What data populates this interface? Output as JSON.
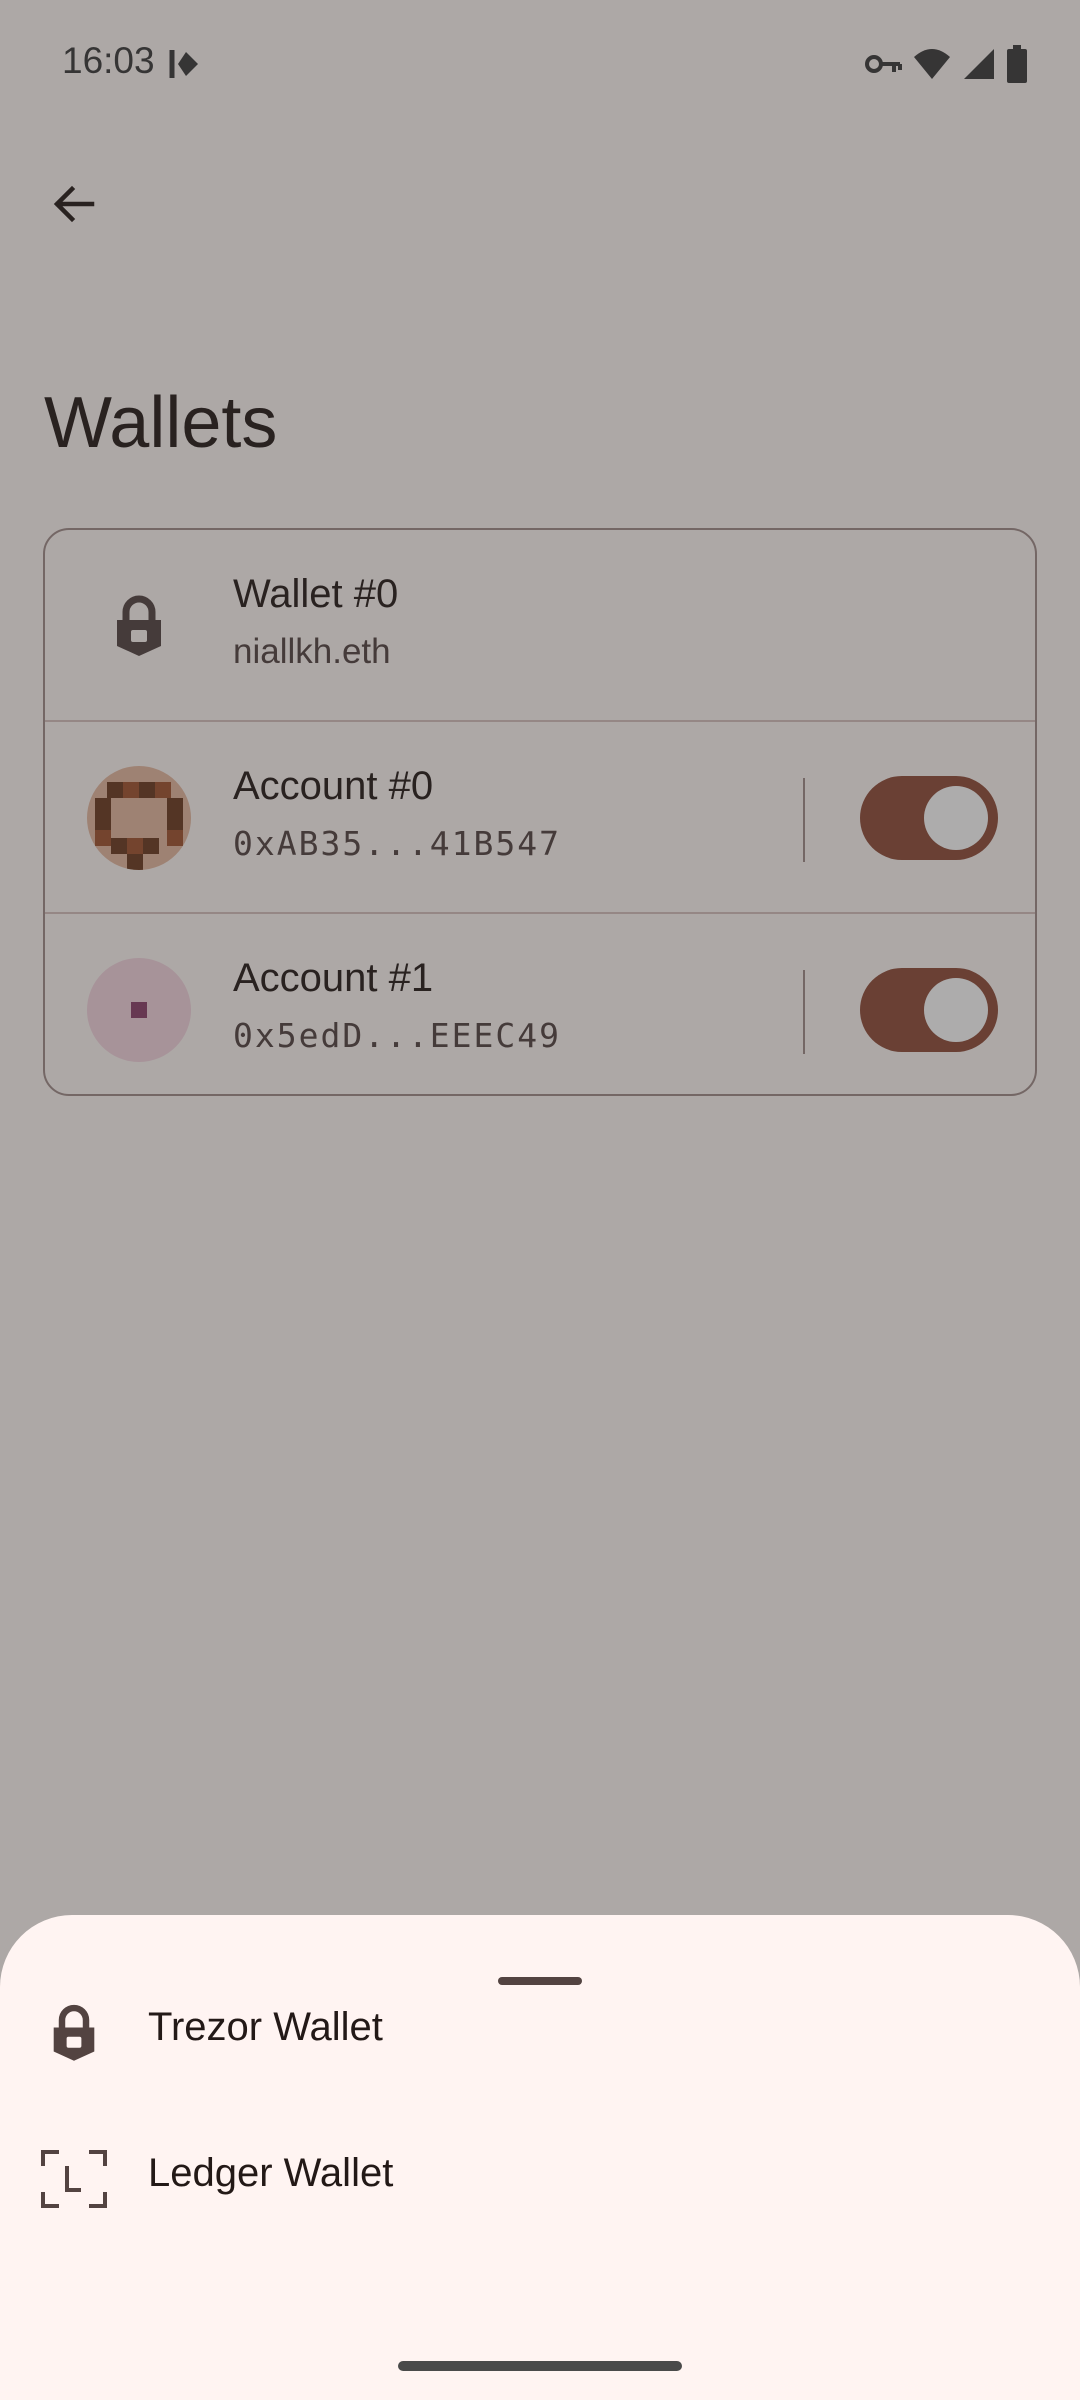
{
  "status_bar": {
    "time": "16:03",
    "left_icon": "kdeconnect-icon",
    "right_icons": [
      "vpn-key-icon",
      "wifi-icon",
      "cell-signal-icon",
      "battery-icon"
    ]
  },
  "header": {
    "back_icon": "arrow-back-icon",
    "title": "Wallets"
  },
  "wallet_card": {
    "wallet": {
      "title": "Wallet #0",
      "subtitle": "niallkh.eth",
      "icon": "lock-icon"
    },
    "accounts": [
      {
        "title": "Account #0",
        "address": "0xAB35...41B547",
        "enabled": true
      },
      {
        "title": "Account #1",
        "address": "0x5edD...EEEC49",
        "enabled": true
      }
    ]
  },
  "bottom_sheet": {
    "items": [
      {
        "label": "Trezor Wallet",
        "icon": "lock-icon"
      },
      {
        "label": "Ledger Wallet",
        "icon": "ledger-scan-icon"
      }
    ]
  },
  "colors": {
    "background": "#FFF8F6",
    "toggle_track": "#8F4C38",
    "scrim": "#322F2F",
    "sheet": "#FFF4F2"
  }
}
